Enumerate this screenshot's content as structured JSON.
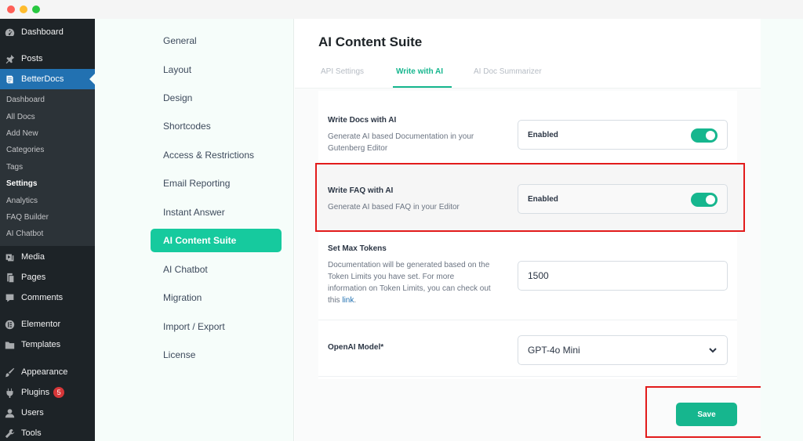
{
  "wp_menu": {
    "dashboard": "Dashboard",
    "posts": "Posts",
    "betterdocs": "BetterDocs",
    "submenu": [
      "Dashboard",
      "All Docs",
      "Add New",
      "Categories",
      "Tags",
      "Settings",
      "Analytics",
      "FAQ Builder",
      "AI Chatbot"
    ],
    "current_submenu": "Settings",
    "media": "Media",
    "pages": "Pages",
    "comments": "Comments",
    "elementor": "Elementor",
    "templates": "Templates",
    "appearance": "Appearance",
    "plugins": "Plugins",
    "plugins_badge": "5",
    "users": "Users",
    "tools": "Tools"
  },
  "settings_nav": {
    "items": [
      "General",
      "Layout",
      "Design",
      "Shortcodes",
      "Access & Restrictions",
      "Email Reporting",
      "Instant Answer",
      "AI Content Suite",
      "AI Chatbot",
      "Migration",
      "Import / Export",
      "License"
    ],
    "active": "AI Content Suite"
  },
  "main": {
    "title": "AI Content Suite",
    "tabs": [
      "API Settings",
      "Write with AI",
      "AI Doc Summarizer"
    ],
    "active_tab": "Write with AI",
    "write_docs": {
      "title": "Write Docs with AI",
      "desc": "Generate AI based Documentation in your Gutenberg Editor",
      "status": "Enabled"
    },
    "write_faq": {
      "title": "Write FAQ with AI",
      "desc": "Generate AI based FAQ in your Editor",
      "status": "Enabled"
    },
    "max_tokens": {
      "title": "Set Max Tokens",
      "desc": "Documentation will be generated based on the Token Limits you have set. For more information on Token Limits, you can check out this",
      "link_text": "link",
      "desc_end": ".",
      "value": "1500"
    },
    "model": {
      "title": "OpenAI Model*",
      "value": "GPT-4o Mini"
    },
    "save_label": "Save"
  },
  "colors": {
    "accent": "#16b68e",
    "wp_sidebar": "#1d2327",
    "wp_active": "#2271b1",
    "highlight": "#e21b1b"
  }
}
